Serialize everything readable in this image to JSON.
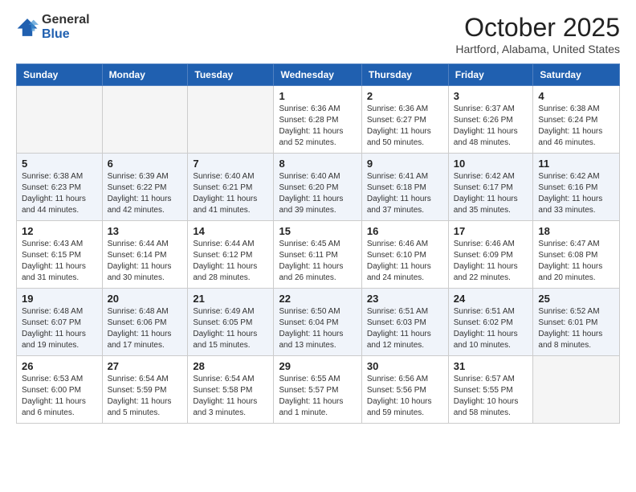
{
  "header": {
    "logo_general": "General",
    "logo_blue": "Blue",
    "month_title": "October 2025",
    "location": "Hartford, Alabama, United States"
  },
  "weekdays": [
    "Sunday",
    "Monday",
    "Tuesday",
    "Wednesday",
    "Thursday",
    "Friday",
    "Saturday"
  ],
  "weeks": [
    [
      {
        "day": "",
        "info": ""
      },
      {
        "day": "",
        "info": ""
      },
      {
        "day": "",
        "info": ""
      },
      {
        "day": "1",
        "info": "Sunrise: 6:36 AM\nSunset: 6:28 PM\nDaylight: 11 hours and 52 minutes."
      },
      {
        "day": "2",
        "info": "Sunrise: 6:36 AM\nSunset: 6:27 PM\nDaylight: 11 hours and 50 minutes."
      },
      {
        "day": "3",
        "info": "Sunrise: 6:37 AM\nSunset: 6:26 PM\nDaylight: 11 hours and 48 minutes."
      },
      {
        "day": "4",
        "info": "Sunrise: 6:38 AM\nSunset: 6:24 PM\nDaylight: 11 hours and 46 minutes."
      }
    ],
    [
      {
        "day": "5",
        "info": "Sunrise: 6:38 AM\nSunset: 6:23 PM\nDaylight: 11 hours and 44 minutes."
      },
      {
        "day": "6",
        "info": "Sunrise: 6:39 AM\nSunset: 6:22 PM\nDaylight: 11 hours and 42 minutes."
      },
      {
        "day": "7",
        "info": "Sunrise: 6:40 AM\nSunset: 6:21 PM\nDaylight: 11 hours and 41 minutes."
      },
      {
        "day": "8",
        "info": "Sunrise: 6:40 AM\nSunset: 6:20 PM\nDaylight: 11 hours and 39 minutes."
      },
      {
        "day": "9",
        "info": "Sunrise: 6:41 AM\nSunset: 6:18 PM\nDaylight: 11 hours and 37 minutes."
      },
      {
        "day": "10",
        "info": "Sunrise: 6:42 AM\nSunset: 6:17 PM\nDaylight: 11 hours and 35 minutes."
      },
      {
        "day": "11",
        "info": "Sunrise: 6:42 AM\nSunset: 6:16 PM\nDaylight: 11 hours and 33 minutes."
      }
    ],
    [
      {
        "day": "12",
        "info": "Sunrise: 6:43 AM\nSunset: 6:15 PM\nDaylight: 11 hours and 31 minutes."
      },
      {
        "day": "13",
        "info": "Sunrise: 6:44 AM\nSunset: 6:14 PM\nDaylight: 11 hours and 30 minutes."
      },
      {
        "day": "14",
        "info": "Sunrise: 6:44 AM\nSunset: 6:12 PM\nDaylight: 11 hours and 28 minutes."
      },
      {
        "day": "15",
        "info": "Sunrise: 6:45 AM\nSunset: 6:11 PM\nDaylight: 11 hours and 26 minutes."
      },
      {
        "day": "16",
        "info": "Sunrise: 6:46 AM\nSunset: 6:10 PM\nDaylight: 11 hours and 24 minutes."
      },
      {
        "day": "17",
        "info": "Sunrise: 6:46 AM\nSunset: 6:09 PM\nDaylight: 11 hours and 22 minutes."
      },
      {
        "day": "18",
        "info": "Sunrise: 6:47 AM\nSunset: 6:08 PM\nDaylight: 11 hours and 20 minutes."
      }
    ],
    [
      {
        "day": "19",
        "info": "Sunrise: 6:48 AM\nSunset: 6:07 PM\nDaylight: 11 hours and 19 minutes."
      },
      {
        "day": "20",
        "info": "Sunrise: 6:48 AM\nSunset: 6:06 PM\nDaylight: 11 hours and 17 minutes."
      },
      {
        "day": "21",
        "info": "Sunrise: 6:49 AM\nSunset: 6:05 PM\nDaylight: 11 hours and 15 minutes."
      },
      {
        "day": "22",
        "info": "Sunrise: 6:50 AM\nSunset: 6:04 PM\nDaylight: 11 hours and 13 minutes."
      },
      {
        "day": "23",
        "info": "Sunrise: 6:51 AM\nSunset: 6:03 PM\nDaylight: 11 hours and 12 minutes."
      },
      {
        "day": "24",
        "info": "Sunrise: 6:51 AM\nSunset: 6:02 PM\nDaylight: 11 hours and 10 minutes."
      },
      {
        "day": "25",
        "info": "Sunrise: 6:52 AM\nSunset: 6:01 PM\nDaylight: 11 hours and 8 minutes."
      }
    ],
    [
      {
        "day": "26",
        "info": "Sunrise: 6:53 AM\nSunset: 6:00 PM\nDaylight: 11 hours and 6 minutes."
      },
      {
        "day": "27",
        "info": "Sunrise: 6:54 AM\nSunset: 5:59 PM\nDaylight: 11 hours and 5 minutes."
      },
      {
        "day": "28",
        "info": "Sunrise: 6:54 AM\nSunset: 5:58 PM\nDaylight: 11 hours and 3 minutes."
      },
      {
        "day": "29",
        "info": "Sunrise: 6:55 AM\nSunset: 5:57 PM\nDaylight: 11 hours and 1 minute."
      },
      {
        "day": "30",
        "info": "Sunrise: 6:56 AM\nSunset: 5:56 PM\nDaylight: 10 hours and 59 minutes."
      },
      {
        "day": "31",
        "info": "Sunrise: 6:57 AM\nSunset: 5:55 PM\nDaylight: 10 hours and 58 minutes."
      },
      {
        "day": "",
        "info": ""
      }
    ]
  ]
}
